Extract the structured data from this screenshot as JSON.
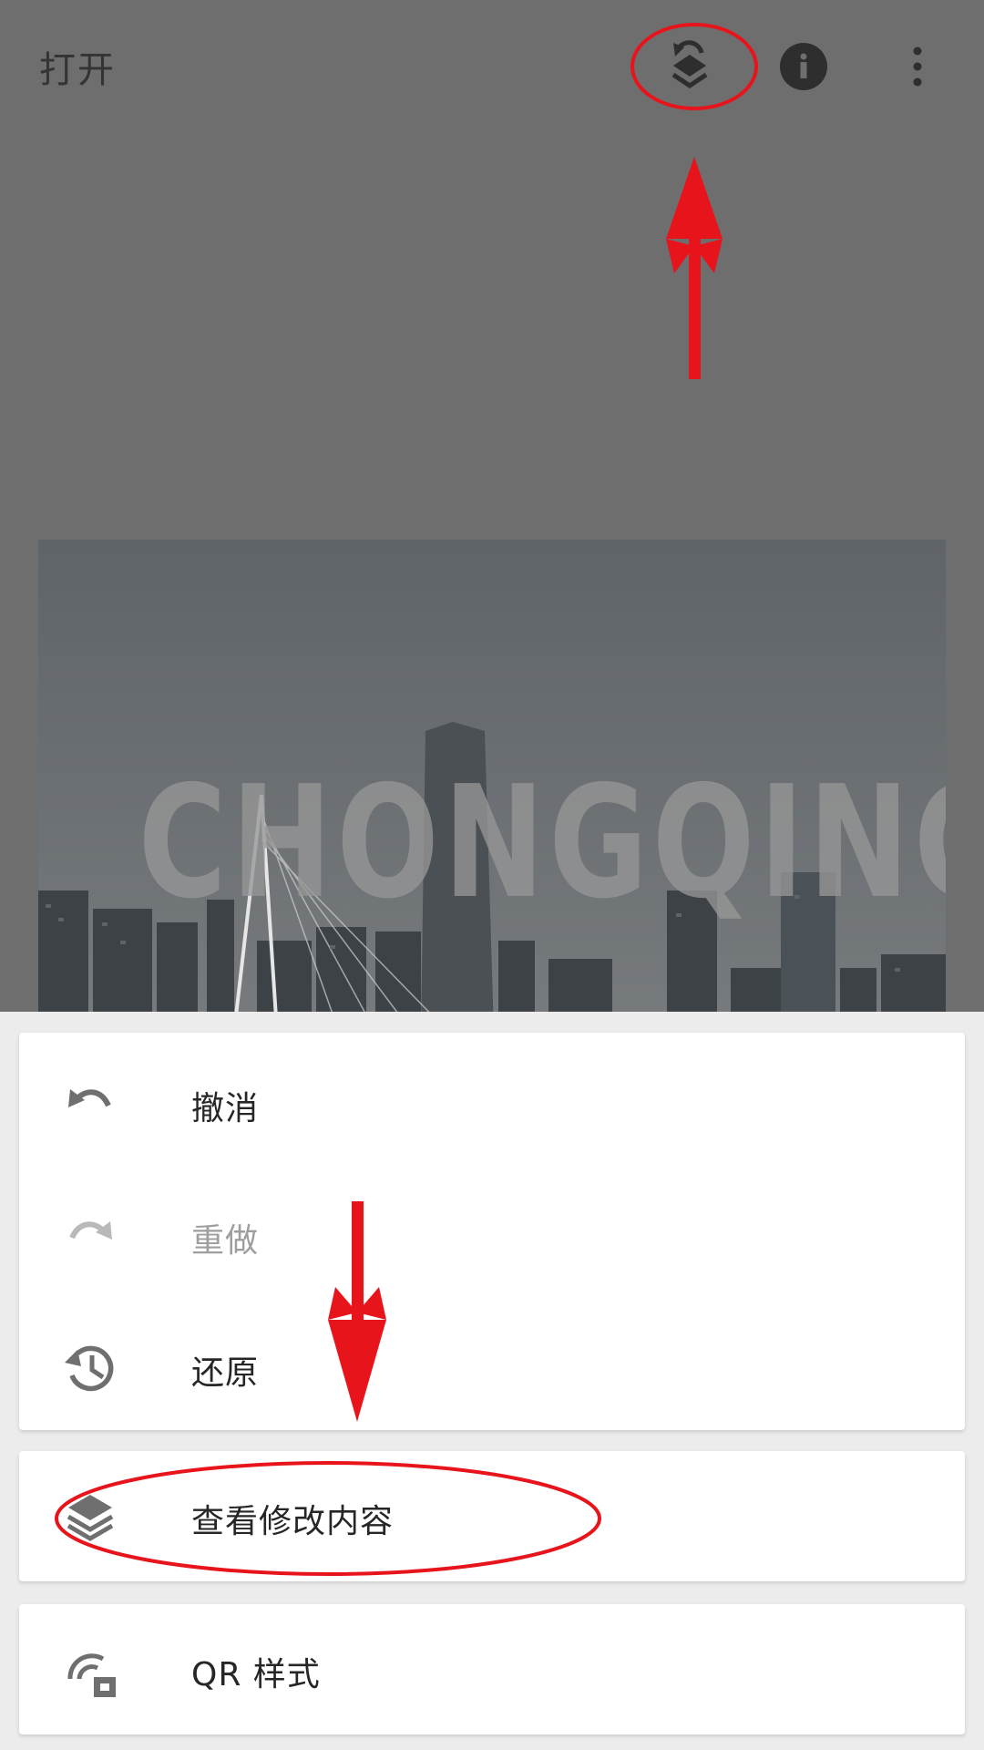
{
  "toolbar": {
    "title": "打开",
    "icons": [
      "stack-history-icon",
      "info-icon",
      "more-vert-icon"
    ]
  },
  "photo": {
    "overlay_text": "CHONGQING"
  },
  "menu": {
    "group1": [
      {
        "label": "撤消",
        "icon": "undo-icon",
        "enabled": true
      },
      {
        "label": "重做",
        "icon": "redo-icon",
        "enabled": false
      },
      {
        "label": "还原",
        "icon": "restore-history-icon",
        "enabled": true
      }
    ],
    "group2": [
      {
        "label": "查看修改内容",
        "icon": "layers-icon",
        "enabled": true
      }
    ],
    "group3": [
      {
        "label": "QR 样式",
        "icon": "qr-style-icon",
        "enabled": true
      }
    ]
  },
  "colors": {
    "annotation": "#e8141c",
    "scrim": "#6e6e6e",
    "sheet_background": "#ececec",
    "card": "#ffffff",
    "text_primary": "#262626",
    "text_disabled": "#9e9e9e",
    "icon": "#6f6f6f"
  }
}
